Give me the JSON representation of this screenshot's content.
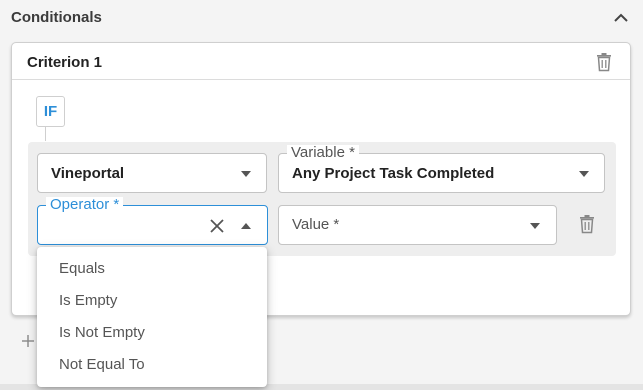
{
  "section": {
    "title": "Conditionals",
    "collapse_icon": "chevron-up-icon"
  },
  "criterion": {
    "title": "Criterion 1",
    "delete_icon": "trash-icon",
    "condition_badge": "IF",
    "rule": {
      "source": {
        "value": "Vineportal"
      },
      "variable": {
        "label": "Variable *",
        "value": "Any Project Task Completed"
      },
      "operator": {
        "label": "Operator *",
        "value": "",
        "clear_icon": "close-icon",
        "open": true,
        "options": [
          "Equals",
          "Is Empty",
          "Is Not Empty",
          "Not Equal To"
        ]
      },
      "value_field": {
        "placeholder": "Value *"
      },
      "delete_icon": "trash-icon"
    },
    "add_icon": "plus-icon"
  },
  "colors": {
    "accent": "#2d8fd8",
    "background": "#f4f4f4",
    "card": "#ffffff",
    "panel": "#eeeeee",
    "border": "#c4c4c4"
  }
}
